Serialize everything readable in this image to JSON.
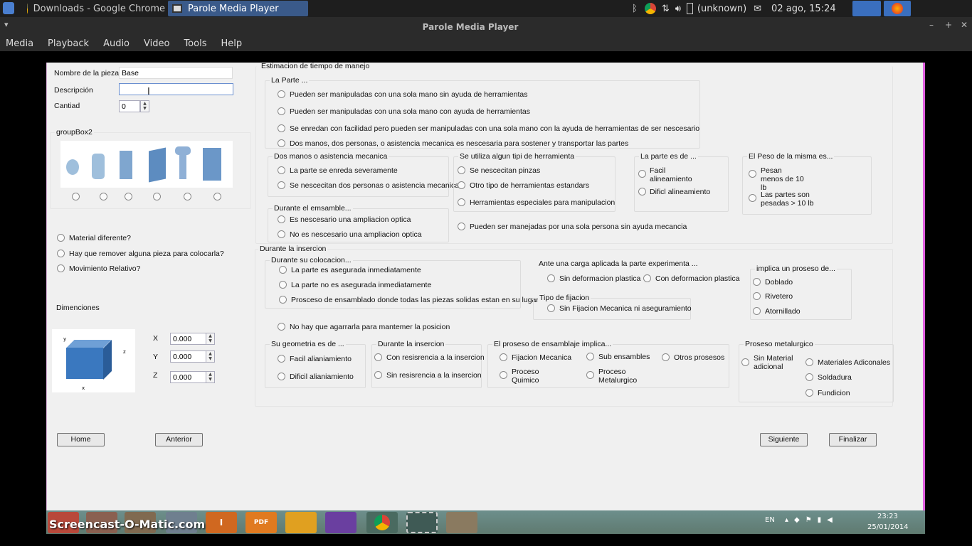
{
  "top_panel": {
    "tasks": [
      {
        "label": "Downloads - Google Chrome"
      },
      {
        "label": "Parole Media Player"
      }
    ],
    "tray": {
      "status": "(unknown)",
      "datetime": "02 ago, 15:24"
    }
  },
  "window": {
    "title": "Parole Media Player",
    "controls": [
      "–",
      "+",
      "✕"
    ]
  },
  "menu": [
    "Media",
    "Playback",
    "Audio",
    "Video",
    "Tools",
    "Help"
  ],
  "app": {
    "fields": {
      "nombre_label": "Nombre de la pieza",
      "nombre_value": "Base",
      "descripcion_label": "Descripción",
      "descripcion_value": "",
      "cantidad_label": "Cantiad",
      "cantidad_value": "0"
    },
    "groupbox2": "groupBox2",
    "checks": [
      "Material diferente?",
      "Hay que remover alguna pieza para colocarla?",
      "Movimiento Relativo?"
    ],
    "dim_label": "Dimenciones",
    "dims": [
      {
        "axis": "X",
        "value": "0.000"
      },
      {
        "axis": "Y",
        "value": "0.000"
      },
      {
        "axis": "Z",
        "value": "0.000"
      }
    ],
    "handling": {
      "title": "Estimacion de tiempo de manejo",
      "la_parte": {
        "title": "La Parte ...",
        "options": [
          "Pueden ser manipuladas con una sola mano sin ayuda de herramientas",
          "Pueden ser manipuladas con una sola mano con ayuda de herramientas",
          "Se enredan con facilidad pero pueden ser manipuladas con una sola mano con la ayuda de herramientas de ser nescesario",
          "Dos manos, dos personas, o asistencia mecanica es nescesaria para sostener y transportar las partes"
        ]
      },
      "dos_manos": {
        "title": "Dos manos o asistencia mecanica",
        "options": [
          "La parte se enreda severamente",
          "Se nescecitan dos personas o asistencia mecanica"
        ]
      },
      "herramienta": {
        "title": "Se utiliza algun tipi de herramienta",
        "options": [
          "Se nescecitan pinzas",
          "Otro tipo de herramientas estandars",
          "Herramientas especiales para manipulacion"
        ]
      },
      "la_parte_es": {
        "title": "La parte es de ...",
        "options": [
          "Facil alineamiento",
          "Dificl alineamiento"
        ]
      },
      "peso": {
        "title": "El Peso de la misma es...",
        "options": [
          "Pesan menos de 10 lb",
          "Las partes son pesadas > 10 lb"
        ]
      },
      "ensamble": {
        "title": "Durante el emsamble...",
        "options": [
          "Es nescesario una ampliacion optica",
          "No es nescesario una ampliacion optica"
        ]
      },
      "una_persona": "Pueden ser manejadas por una sola persona sin ayuda mecancia"
    },
    "insertion": {
      "title": "Durante la insercion",
      "colocacion": {
        "title": "Durante su colocacion...",
        "options": [
          "La parte  es asegurada inmediatamente",
          "La parte no es asegurada inmediatamente",
          "Prosceso de ensamblado donde todas las piezas solidas estan en su lugar"
        ]
      },
      "carga": {
        "title": "Ante una carga aplicada la parte experimenta ...",
        "options": [
          "Sin deformacion plastica",
          "Con deformacion plastica"
        ]
      },
      "fijacion": {
        "title": "Tipo de fijacion",
        "options": [
          "Sin Fijacion Mecanica ni aseguramiento"
        ]
      },
      "proseso": {
        "title": "implica un  proseso de...",
        "options": [
          "Doblado",
          "Rivetero",
          "Atornillado"
        ]
      },
      "no_agarrar": "No hay que agarrarla para mantemer la posicion",
      "geometria": {
        "title": "Su geometria es de ...",
        "options": [
          "Facil alianiamiento",
          "Dificil alianiamiento"
        ]
      },
      "durante_ins": {
        "title": "Durante la insercion",
        "options": [
          "Con resisrencia a la insercion",
          "Sin resisrencia a la insercion"
        ]
      },
      "ensamblaje": {
        "title": "El proseso de ensamblaje implica...",
        "options": [
          "Fijacion Mecanica",
          "Sub ensambles",
          "Otros prosesos",
          "Proceso Quimico",
          "Proceso Metalurgico"
        ]
      },
      "metalurgico": {
        "title": "Proseso metalurgico",
        "options": [
          "Sin Material adicional",
          "Materiales Adiconales",
          "Soldadura",
          "Fundicion"
        ]
      }
    },
    "buttons": {
      "home": "Home",
      "anterior": "Anterior",
      "siguiente": "Siguiente",
      "finalizar": "Finalizar"
    }
  },
  "watermark": "Screencast-O-Matic.com",
  "win_tray": {
    "lang": "EN",
    "time": "23:23",
    "date": "25/01/2014"
  }
}
